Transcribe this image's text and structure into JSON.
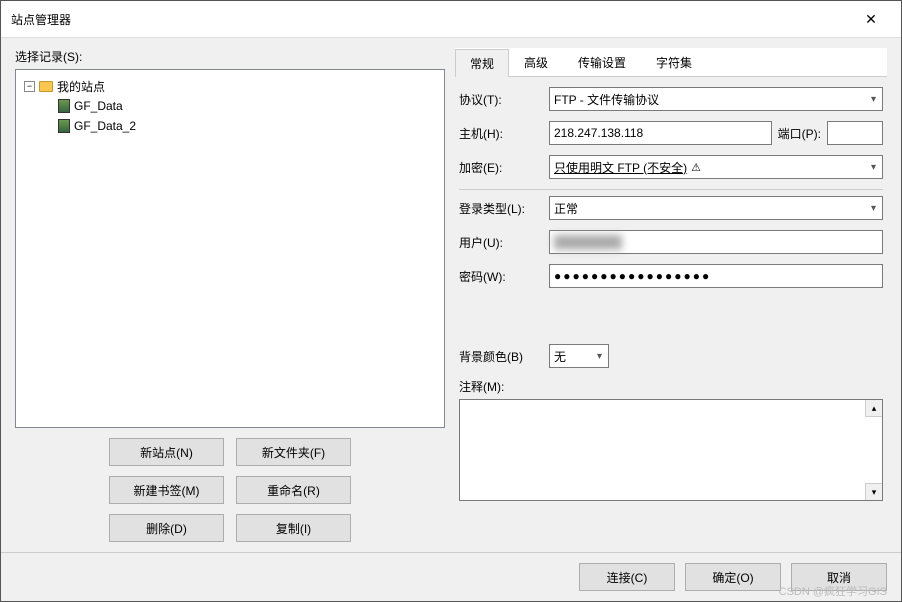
{
  "titlebar": {
    "title": "站点管理器"
  },
  "left": {
    "select_label": "选择记录(S):",
    "tree": {
      "root": "我的站点",
      "items": [
        "GF_Data",
        "GF_Data_2"
      ]
    },
    "buttons": {
      "new_site": "新站点(N)",
      "new_folder": "新文件夹(F)",
      "new_bookmark": "新建书签(M)",
      "rename": "重命名(R)",
      "delete": "删除(D)",
      "copy": "复制(I)"
    }
  },
  "right": {
    "tabs": [
      "常规",
      "高级",
      "传输设置",
      "字符集"
    ],
    "active_tab": 0,
    "form": {
      "protocol_label": "协议(T):",
      "protocol_value": "FTP - 文件传输协议",
      "host_label": "主机(H):",
      "host_value": "218.247.138.118",
      "port_label": "端口(P):",
      "port_value": "",
      "encryption_label": "加密(E):",
      "encryption_value": "只使用明文 FTP (不安全)",
      "login_type_label": "登录类型(L):",
      "login_type_value": "正常",
      "user_label": "用户(U):",
      "user_value": "hidden",
      "password_label": "密码(W):",
      "password_value": "●●●●●●●●●●●●●●●●●",
      "bgcolor_label": "背景颜色(B)",
      "bgcolor_value": "无",
      "comment_label": "注释(M):"
    }
  },
  "footer": {
    "connect": "连接(C)",
    "ok": "确定(O)",
    "cancel": "取消"
  },
  "watermark": "CSDN @疯狂学习GIS"
}
